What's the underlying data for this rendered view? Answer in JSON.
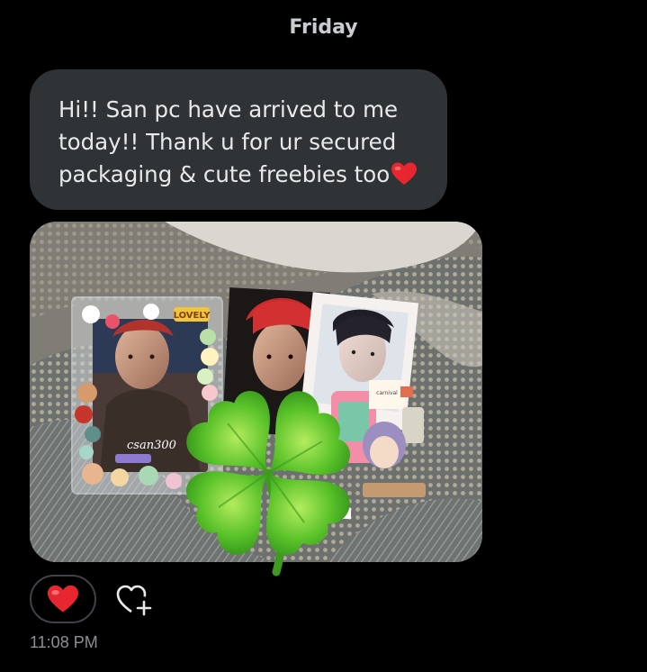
{
  "chat": {
    "date_label": "Friday",
    "message": {
      "text": "Hi!! San pc have arrived to me today!! Thank u for ur secured packaging & cute freebies too",
      "emoji": "red-heart"
    },
    "attachment": {
      "type": "photo",
      "sticker": "four-leaf-clover",
      "visible_text": [
        "LOVELY",
        "csan300"
      ]
    },
    "reactions": [
      {
        "icon": "red-heart-icon",
        "selected": true
      }
    ],
    "add_reaction_icon": "heart-plus-icon",
    "timestamp": "11:08 PM"
  },
  "colors": {
    "background": "#000000",
    "bubble": "#2f3336",
    "text": "#e7e9ea",
    "muted": "#8b9096",
    "heart": "#e0245e"
  }
}
